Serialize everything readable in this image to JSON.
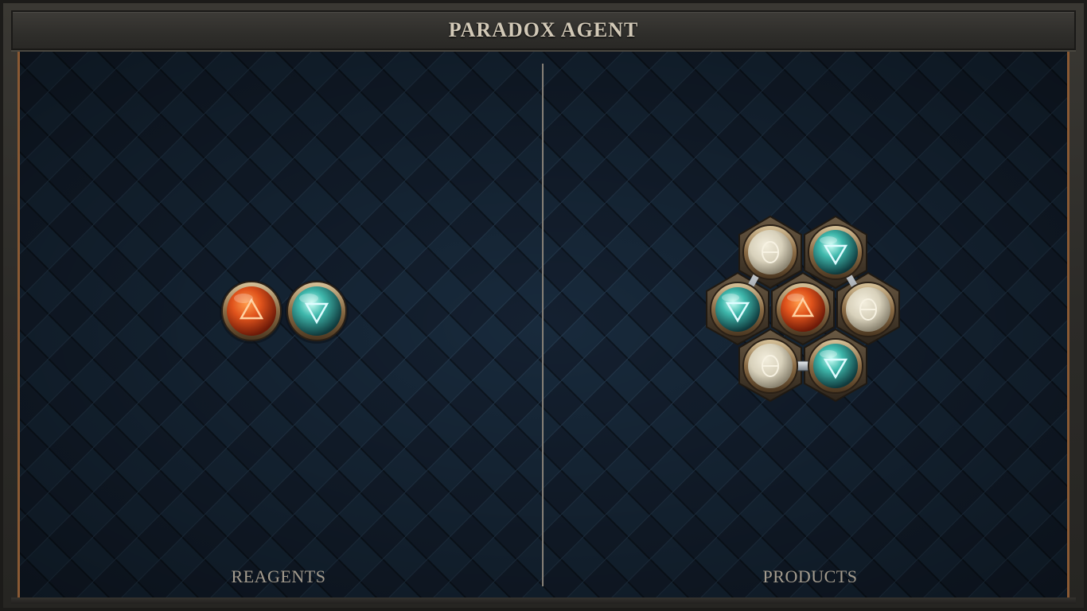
{
  "title": "PARADOX AGENT",
  "panels": {
    "reagents": {
      "label": "REAGENTS",
      "atoms": [
        {
          "element": "fire",
          "symbol": "△"
        },
        {
          "element": "water",
          "symbol": "▽"
        }
      ]
    },
    "products": {
      "label": "PRODUCTS",
      "atoms": [
        {
          "element": "salt",
          "symbol": "⊖"
        },
        {
          "element": "water",
          "symbol": "▽"
        },
        {
          "element": "water",
          "symbol": "▽"
        },
        {
          "element": "fire",
          "symbol": "△"
        },
        {
          "element": "salt",
          "symbol": "⊖"
        },
        {
          "element": "salt",
          "symbol": "⊖"
        },
        {
          "element": "water",
          "symbol": "▽"
        }
      ]
    }
  },
  "colors": {
    "fire": "#e0531c",
    "water": "#3fb8ac",
    "salt": "#d8d1bb",
    "board": "#152231",
    "frame_accent": "#8a5a34"
  }
}
